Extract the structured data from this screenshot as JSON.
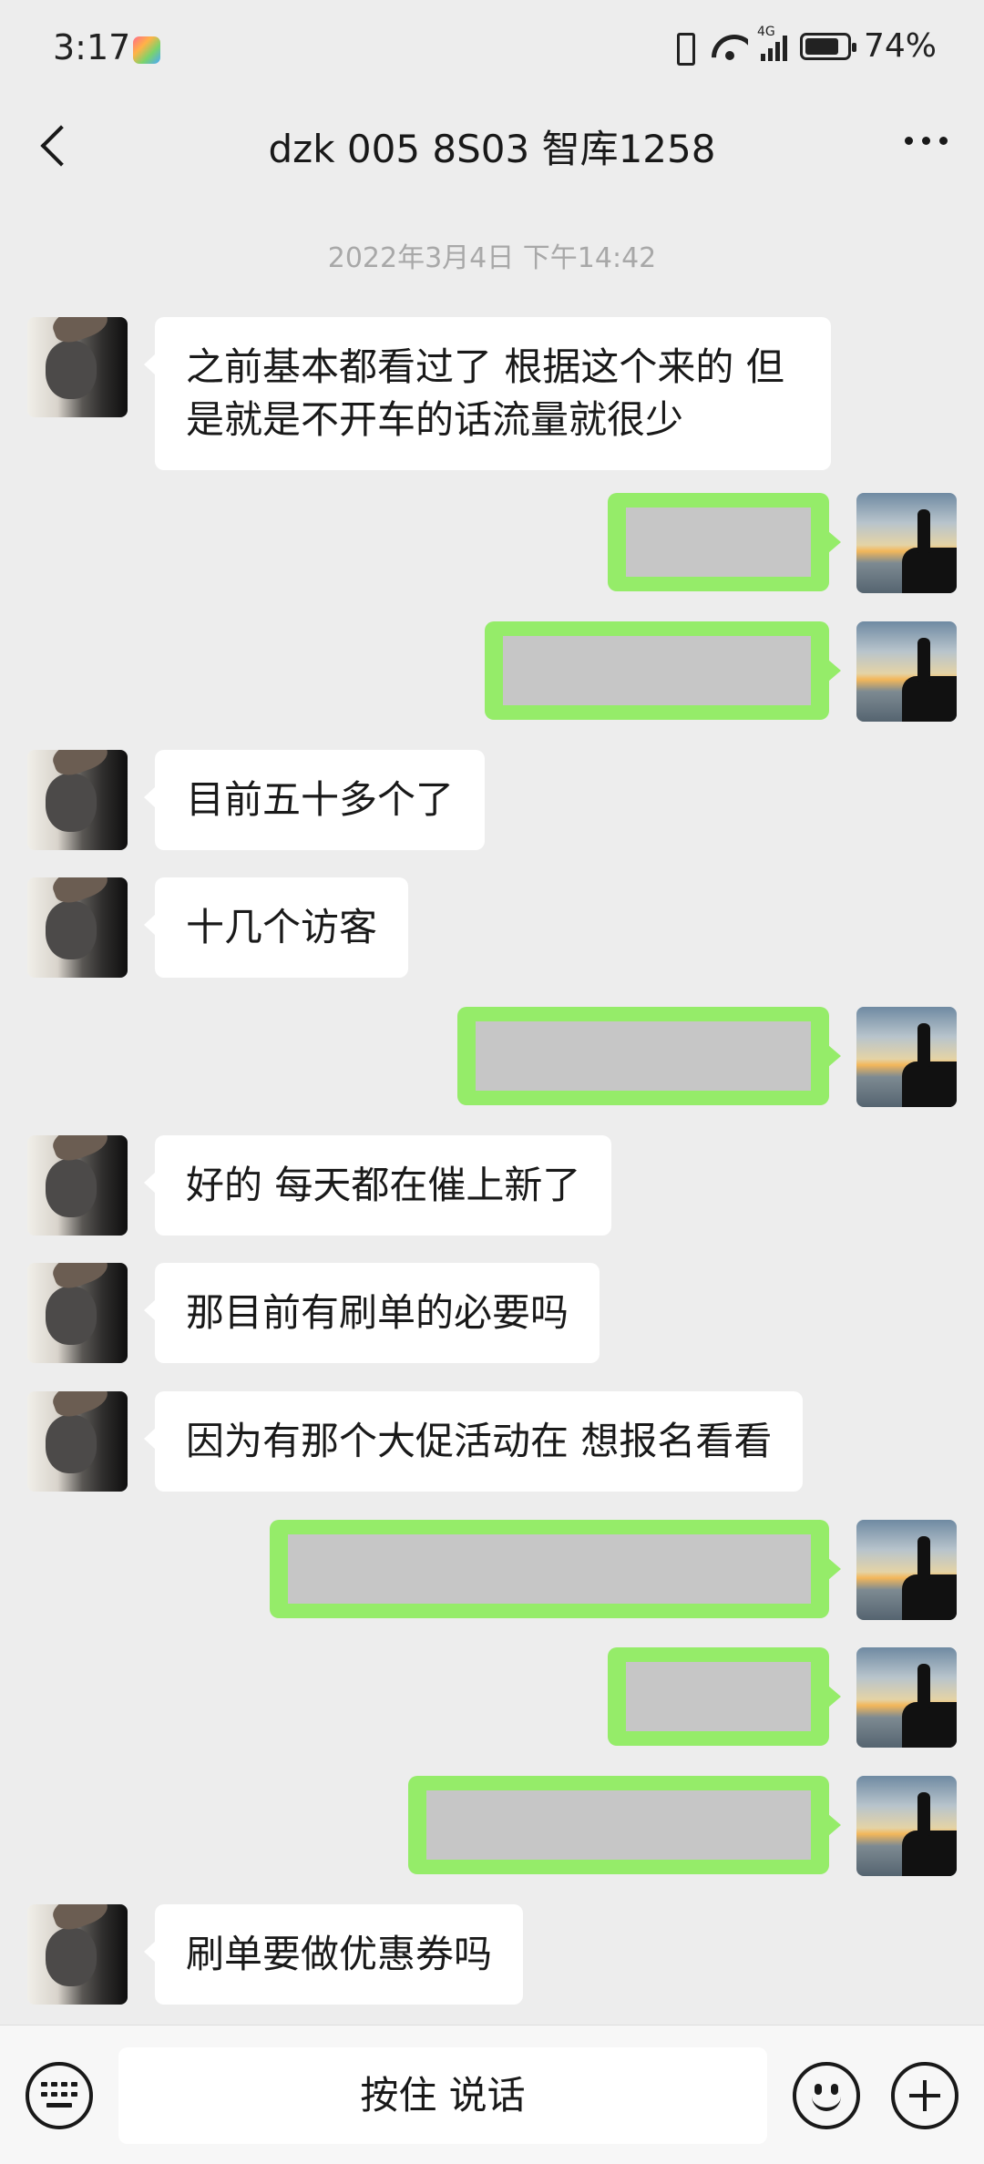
{
  "status_bar": {
    "time": "3:17",
    "battery": "74%",
    "network": "4G"
  },
  "header": {
    "title": "dzk 005 8S03 智库1258"
  },
  "timestamp": "2022年3月4日 下午14:42",
  "messages": [
    {
      "side": "left",
      "text": "之前基本都看过了 根据这个来的 但是就是不开车的话流量就很少"
    },
    {
      "side": "right",
      "text": ""
    },
    {
      "side": "right",
      "text": ""
    },
    {
      "side": "left",
      "text": "目前五十多个了"
    },
    {
      "side": "left",
      "text": "十几个访客"
    },
    {
      "side": "right",
      "text": ""
    },
    {
      "side": "left",
      "text": "好的 每天都在催上新了"
    },
    {
      "side": "left",
      "text": "那目前有刷单的必要吗"
    },
    {
      "side": "left",
      "text": "因为有那个大促活动在 想报名看看"
    },
    {
      "side": "right",
      "text": ""
    },
    {
      "side": "right",
      "text": ""
    },
    {
      "side": "right",
      "text": ""
    },
    {
      "side": "left",
      "text": "刷单要做优惠券吗"
    }
  ],
  "input_bar": {
    "voice_label": "按住 说话"
  },
  "colors": {
    "background": "#ededed",
    "sent_bubble": "#95ec69",
    "received_bubble": "#ffffff",
    "redaction": "#c6c6c6"
  }
}
